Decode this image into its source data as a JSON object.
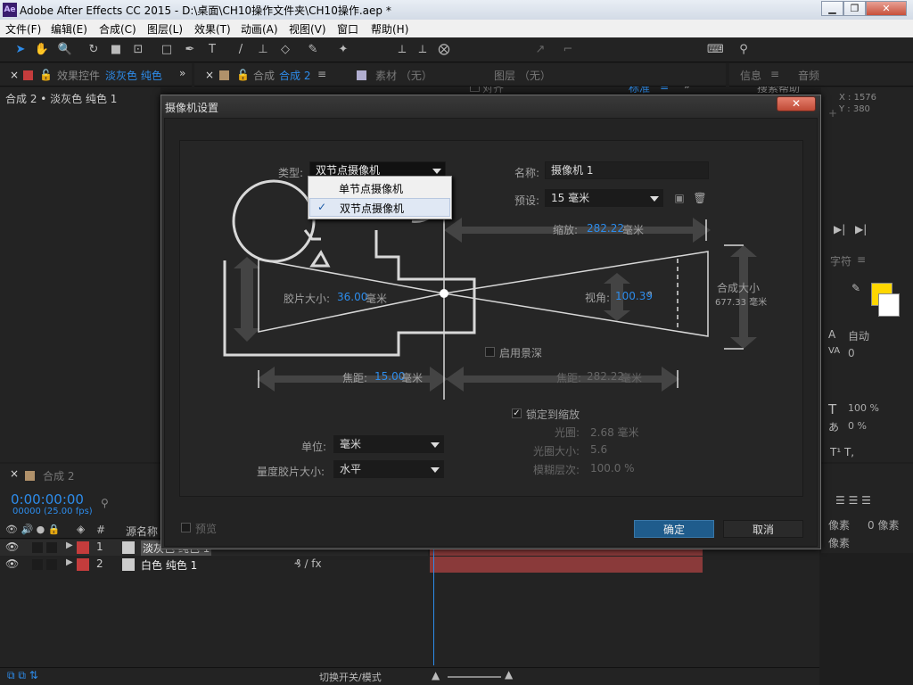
{
  "app": {
    "icon_label": "Ae",
    "title": "Adobe After Effects CC 2015 - D:\\桌面\\CH10操作文件夹\\CH10操作.aep *"
  },
  "menu": [
    "文件(F)",
    "编辑(E)",
    "合成(C)",
    "图层(L)",
    "效果(T)",
    "动画(A)",
    "视图(V)",
    "窗口",
    "帮助(H)"
  ],
  "toolbar": {
    "snap_label": "对齐",
    "workspace": "标准",
    "workspace_sep": "≡",
    "more": "»",
    "search_placeholder": "搜索帮助"
  },
  "panels": {
    "effects_tab": "效果控件",
    "effects_layer": "淡灰色 纯色",
    "effects_more": "»",
    "comp_tab": "合成",
    "comp_name": "合成 2",
    "menu_icon": "≡",
    "footage_tab": "素材 （无）",
    "layer_tab": "图层 （无）",
    "info_tab": "信息",
    "audio_tab": "音频",
    "breadcrumb": "合成 2 • 淡灰色 纯色 1",
    "info_x": "X : 1576",
    "info_y": "Y : 380",
    "char_tab": "字符",
    "font_style": "自动",
    "kerning": "0",
    "scale_v": "100 %",
    "scale_h": "0 %",
    "para_px1": "像素",
    "para_px2": "0 像素",
    "para_px3": "像素"
  },
  "timeline": {
    "tab": "合成 2",
    "timecode": "0:00:00:00",
    "fps": "00000 (25.00 fps)",
    "col_source": "源名称",
    "col_num": "#",
    "layers": [
      {
        "num": "1",
        "name": "淡灰色 纯色 1"
      },
      {
        "num": "2",
        "name": "白色 纯色 1"
      }
    ],
    "toggle_modes": "切换开关/模式"
  },
  "dialog": {
    "title": "摄像机设置",
    "close": "✕",
    "type_label": "类型:",
    "type_value": "双节点摄像机",
    "dropdown_items": [
      {
        "label": "单节点摄像机",
        "checked": false
      },
      {
        "label": "双节点摄像机",
        "checked": true
      }
    ],
    "check_mark": "✓",
    "name_label": "名称:",
    "name_value": "摄像机 1",
    "preset_label": "预设:",
    "preset_value": "15 毫米",
    "zoom_label": "缩放:",
    "zoom_value": "282.22",
    "zoom_unit": "毫米",
    "film_label": "胶片大小:",
    "film_value": "36.00",
    "film_unit": "毫米",
    "angle_label": "视角:",
    "angle_value": "100.39",
    "angle_unit": "°",
    "comp_size_label": "合成大小",
    "comp_size_value": "677.33 毫米",
    "dof_label": "启用景深",
    "focal_label": "焦距:",
    "focal_value": "15.00",
    "focal_unit": "毫米",
    "focus_dist_label": "焦距:",
    "focus_dist_value": "282.22",
    "focus_dist_unit": "毫米",
    "lock_zoom_label": "锁定到缩放",
    "aperture_label": "光圈:",
    "aperture_value": "2.68 毫米",
    "fstop_label": "光圈大小:",
    "fstop_value": "5.6",
    "blur_label": "模糊层次:",
    "blur_value": "100.0 %",
    "units_label": "单位:",
    "units_value": "毫米",
    "measure_label": "量度胶片大小:",
    "measure_value": "水平",
    "preview_label": "预览",
    "ok_label": "确定",
    "cancel_label": "取消"
  },
  "colors": {
    "accent": "#2d8ceb",
    "ok": "#1f5c8c",
    "layer_label": "#c43c3c",
    "fill_swatch": "#ffd700"
  }
}
